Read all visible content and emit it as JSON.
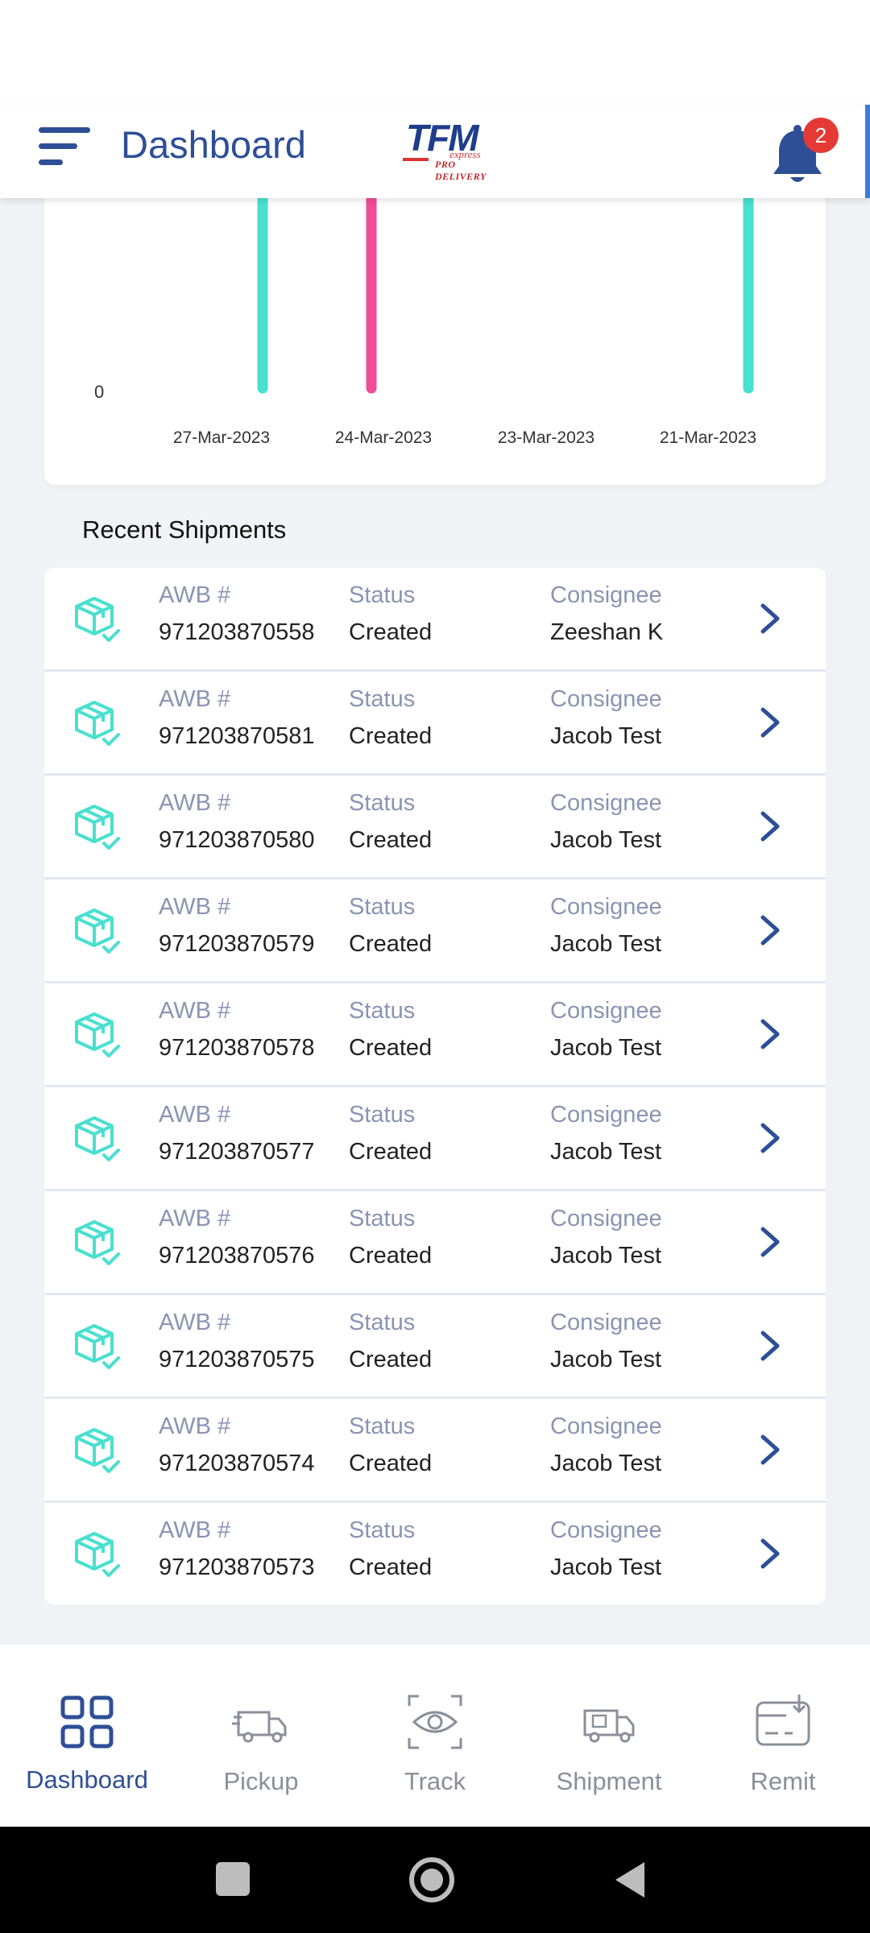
{
  "header": {
    "title": "Dashboard",
    "logo_text": "TFM",
    "logo_sub": "express",
    "logo_tag": "PRO DELIVERY",
    "notification_count": "2"
  },
  "chart_data": {
    "type": "bar",
    "y_tick_label": "0",
    "categories": [
      "27-Mar-2023",
      "24-Mar-2023",
      "23-Mar-2023",
      "21-Mar-2023"
    ],
    "colors": {
      "teal": "#48e0cf",
      "pink": "#f04c9a"
    }
  },
  "recent": {
    "title": "Recent Shipments",
    "col_awb": "AWB #",
    "col_status": "Status",
    "col_consignee": "Consignee",
    "rows": [
      {
        "awb": "971203870558",
        "status": "Created",
        "consignee": "Zeeshan K"
      },
      {
        "awb": "971203870581",
        "status": "Created",
        "consignee": "Jacob Test"
      },
      {
        "awb": "971203870580",
        "status": "Created",
        "consignee": "Jacob Test"
      },
      {
        "awb": "971203870579",
        "status": "Created",
        "consignee": "Jacob Test"
      },
      {
        "awb": "971203870578",
        "status": "Created",
        "consignee": "Jacob Test"
      },
      {
        "awb": "971203870577",
        "status": "Created",
        "consignee": "Jacob Test"
      },
      {
        "awb": "971203870576",
        "status": "Created",
        "consignee": "Jacob Test"
      },
      {
        "awb": "971203870575",
        "status": "Created",
        "consignee": "Jacob Test"
      },
      {
        "awb": "971203870574",
        "status": "Created",
        "consignee": "Jacob Test"
      },
      {
        "awb": "971203870573",
        "status": "Created",
        "consignee": "Jacob Test"
      }
    ]
  },
  "nav": {
    "items": [
      {
        "label": "Dashboard",
        "icon": "grid-icon",
        "active": true
      },
      {
        "label": "Pickup",
        "icon": "truck-icon",
        "active": false
      },
      {
        "label": "Track",
        "icon": "eye-scan-icon",
        "active": false
      },
      {
        "label": "Shipment",
        "icon": "delivery-truck-icon",
        "active": false
      },
      {
        "label": "Remit",
        "icon": "card-download-icon",
        "active": false
      }
    ]
  },
  "colors": {
    "primary": "#2e4f96",
    "accent_teal": "#48e0cf",
    "badge_red": "#e53935"
  }
}
